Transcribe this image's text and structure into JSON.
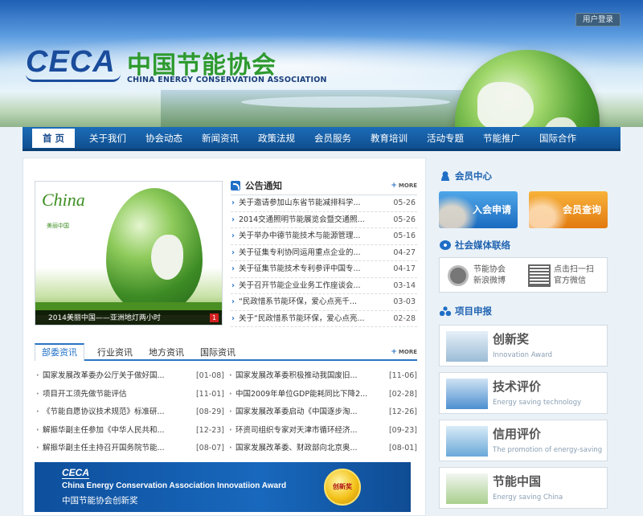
{
  "header": {
    "logo_en_short": "CECA",
    "logo_cn": "中国节能协会",
    "logo_en": "CHINA ENERGY CONSERVATION ASSOCIATION",
    "login_label": "用户登录"
  },
  "nav": {
    "items": [
      "首 页",
      "关于我们",
      "协会动态",
      "新闻资讯",
      "政策法规",
      "会员服务",
      "教育培训",
      "活动专题",
      "节能推广",
      "国际合作"
    ]
  },
  "slideshow": {
    "brand": "China",
    "brand_sub": "美丽中国",
    "caption": "2014美丽中国——亚洲地灯两小时",
    "page": "1"
  },
  "notice": {
    "title": "公告通知",
    "more": "MORE",
    "items": [
      {
        "title": "关于邀请参加山东省节能减排科学...",
        "date": "05-26"
      },
      {
        "title": "2014交通照明节能展览会暨交通照...",
        "date": "05-26"
      },
      {
        "title": "关于举办中德节能技术与能源管理...",
        "date": "05-16"
      },
      {
        "title": "关于征集专利协同运用重点企业的...",
        "date": "04-27"
      },
      {
        "title": "关于征集节能技术专利参评中国专...",
        "date": "04-17"
      },
      {
        "title": "关于召开节能企业业务工作座谈会...",
        "date": "03-14"
      },
      {
        "title": "“民政惜系节能环保，爱心点亮千...",
        "date": "03-03"
      },
      {
        "title": "关于“民政惜系节能环保，爱心点亮...",
        "date": "02-28"
      }
    ]
  },
  "tabs": {
    "items": [
      "部委资讯",
      "行业资讯",
      "地方资讯",
      "国际资讯"
    ],
    "more": "MORE"
  },
  "news": {
    "left": [
      {
        "title": "国家发展改革委办公厅关于做好国...",
        "date": "[01-08]"
      },
      {
        "title": "项目开工须先做节能评估",
        "date": "[11-01]"
      },
      {
        "title": "《节能自愿协议技术规范》标准研...",
        "date": "[08-29]"
      },
      {
        "title": "解振华副主任参加《中华人民共和...",
        "date": "[12-23]"
      },
      {
        "title": "解振华副主任主持召开国务院节能...",
        "date": "[08-07]"
      }
    ],
    "right": [
      {
        "title": "国家发展改革委积极推动我国废旧...",
        "date": "[11-06]"
      },
      {
        "title": "中国2009年单位GDP能耗同比下降2...",
        "date": "[02-28]"
      },
      {
        "title": "国家发展改革委启动《中国逐步淘...",
        "date": "[12-26]"
      },
      {
        "title": "环资司组织专家对天津市循环经济...",
        "date": "[09-23]"
      },
      {
        "title": "国家发展改革委、财政部向北京奥...",
        "date": "[08-01]"
      }
    ]
  },
  "award": {
    "logo": "CECA",
    "en": "China Energy Conservation Association Innovatiion Award",
    "cn": "中国节能协会创新奖",
    "medal": "创新奖"
  },
  "sidebar": {
    "member_title": "会员中心",
    "join_label": "入会申请",
    "query_label": "会员查询",
    "social_title": "社会媒体联络",
    "weibo_line1": "节能协会",
    "weibo_line2": "新浪微博",
    "wechat_line1": "点击扫一扫",
    "wechat_line2": "官方微信",
    "project_title": "项目申报",
    "projects": [
      {
        "title": "创新奖",
        "subtitle": "Innovation Award"
      },
      {
        "title": "技术评价",
        "subtitle": "Energy saving technology"
      },
      {
        "title": "信用评价",
        "subtitle": "The promotion of energy-saving"
      },
      {
        "title": "节能中国",
        "subtitle": "Energy saving China"
      }
    ]
  },
  "colors": {
    "brand_blue": "#1a4c9c",
    "brand_green": "#2e9a2e",
    "nav_blue": "#1c6cb8"
  }
}
